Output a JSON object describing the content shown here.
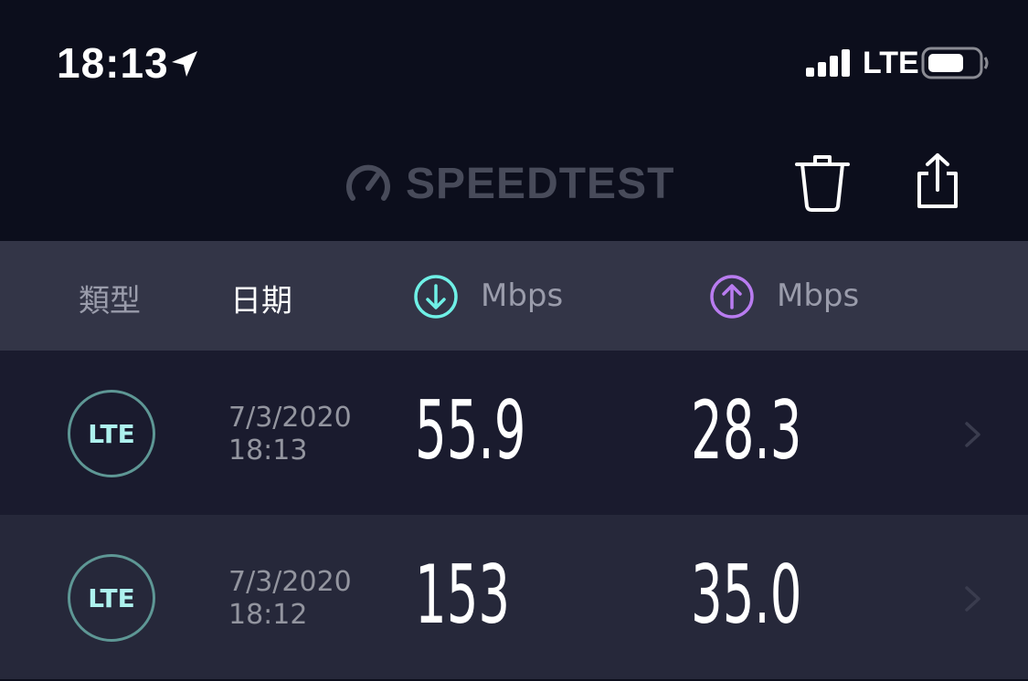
{
  "status_bar": {
    "time": "18:13",
    "carrier": "LTE",
    "icons": [
      "location-arrow-icon",
      "signal-bars-icon",
      "battery-icon"
    ]
  },
  "header": {
    "logo_text": "SPEEDTEST",
    "logo_icon": "speedometer-icon",
    "actions": [
      "trash-icon",
      "share-icon"
    ]
  },
  "columns": {
    "type": "類型",
    "date": "日期",
    "download_unit": "Mbps",
    "upload_unit": "Mbps"
  },
  "results": [
    {
      "type": "LTE",
      "date": "7/3/2020",
      "time": "18:13",
      "download": "55.9",
      "upload": "28.3"
    },
    {
      "type": "LTE",
      "date": "7/3/2020",
      "time": "18:12",
      "download": "153",
      "upload": "35.0"
    }
  ],
  "colors": {
    "background": "#0c0e1c",
    "header_band": "#333547",
    "row_odd": "#1a1b2e",
    "row_even": "#26283a",
    "download_accent": "#6ff0e6",
    "upload_accent": "#b97cf0",
    "badge_border": "#5e9795"
  }
}
